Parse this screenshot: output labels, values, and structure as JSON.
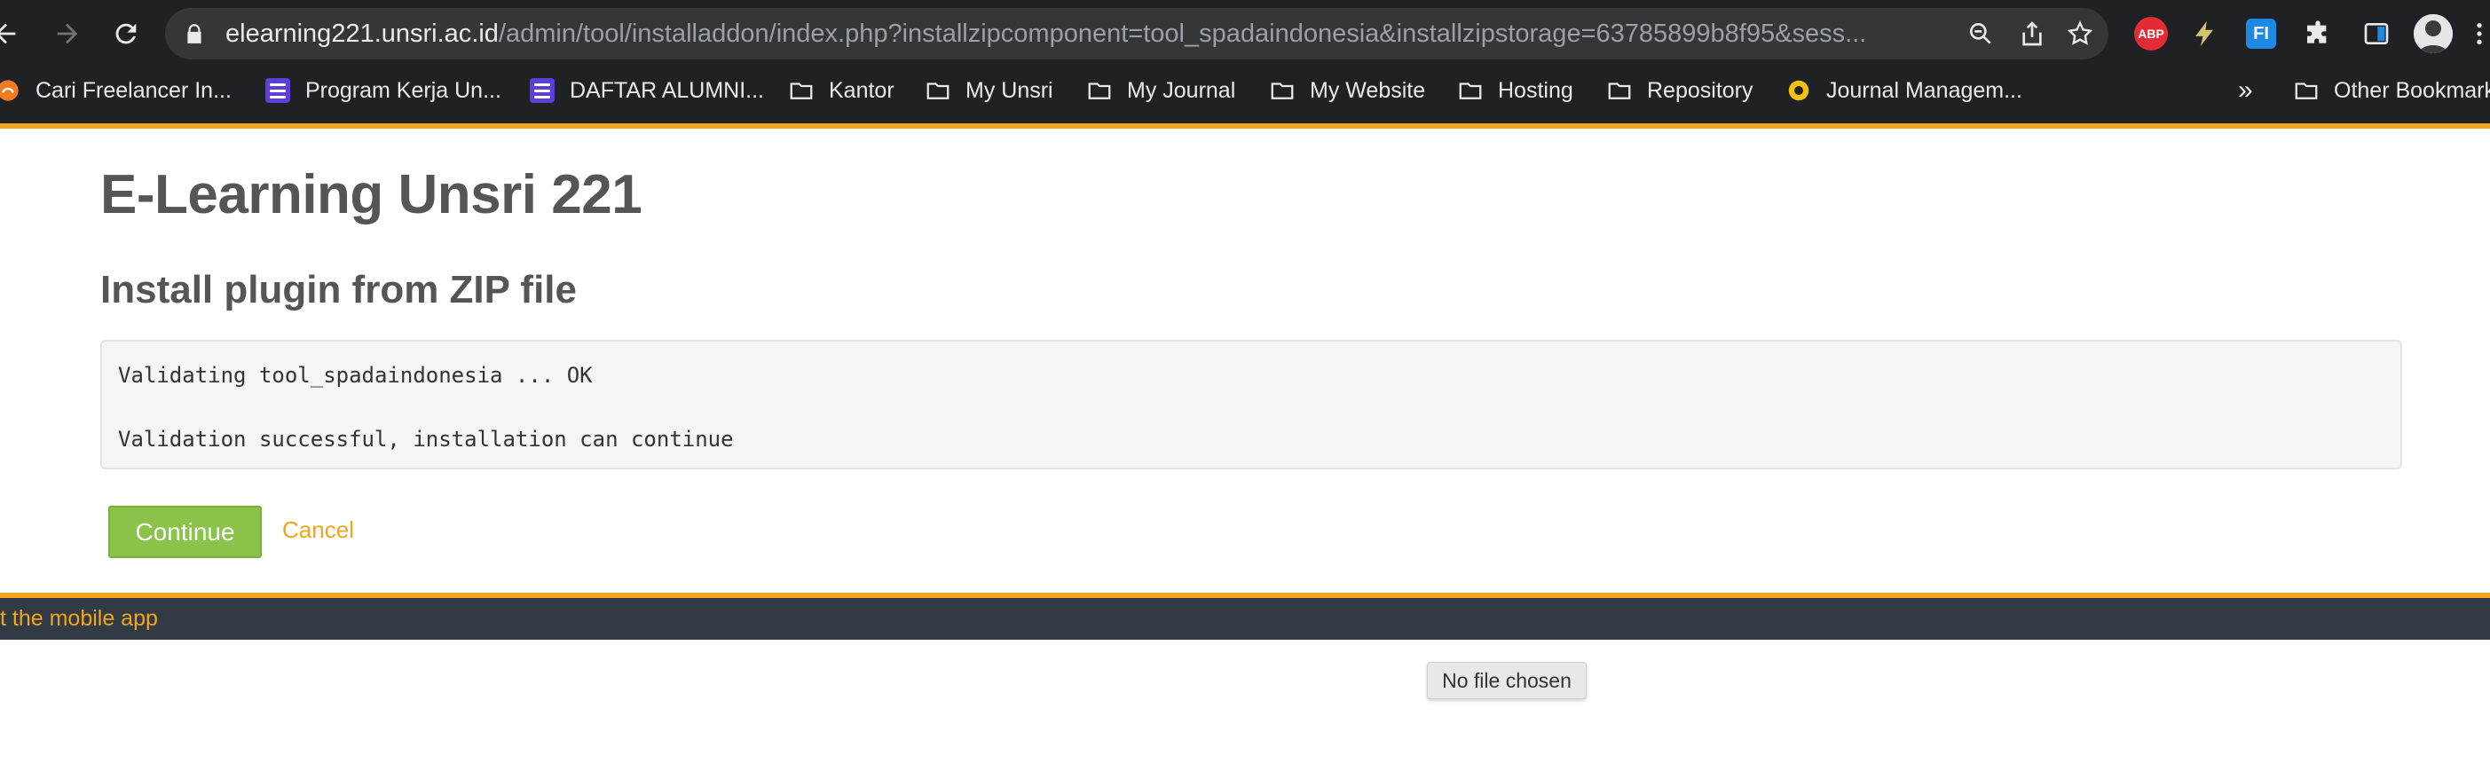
{
  "browser": {
    "url_host": "elearning221.unsri.ac.id",
    "url_path": "/admin/tool/installaddon/index.php?installzipcomponent=tool_spadaindonesia&installzipstorage=63785899b8f95&sess...",
    "icons": [
      "back-arrow-icon",
      "forward-arrow-icon",
      "reload-icon",
      "lock-icon",
      "zoom-icon",
      "share-icon",
      "bookmark-star-icon",
      "adblock-plus-icon",
      "lightning-extension-icon",
      "fi-extension-icon",
      "puzzle-extensions-icon",
      "sidebar-icon",
      "profile-avatar",
      "menu-dots-icon"
    ],
    "abp_label": "ABP",
    "fi_label": "FI",
    "overflow_label": "»",
    "bookmarks": [
      {
        "label": "Cari Freelancer In...",
        "icon": "orange-site-icon"
      },
      {
        "label": "Program Kerja Un...",
        "icon": "purple-list-icon"
      },
      {
        "label": "DAFTAR ALUMNI...",
        "icon": "purple-list-icon"
      },
      {
        "label": "Kantor",
        "icon": "folder-icon"
      },
      {
        "label": "My Unsri",
        "icon": "folder-icon"
      },
      {
        "label": "My Journal",
        "icon": "folder-icon"
      },
      {
        "label": "My Website",
        "icon": "folder-icon"
      },
      {
        "label": "Hosting",
        "icon": "folder-icon"
      },
      {
        "label": "Repository",
        "icon": "folder-icon"
      },
      {
        "label": "Journal Managem...",
        "icon": "yellow-flower-icon"
      },
      {
        "label": "Other Bookmarks",
        "icon": "folder-icon"
      }
    ]
  },
  "page": {
    "site_name": "E-Learning Unsri 221",
    "heading": "Install plugin from ZIP file",
    "log": {
      "line1": "Validating tool_spadaindonesia ... OK",
      "line2": "Validation successful, installation can continue"
    },
    "continue_label": "Continue",
    "cancel_label": "Cancel"
  },
  "footer": {
    "link_label": "t the mobile app"
  },
  "file_input": {
    "status": "No file chosen"
  },
  "colors": {
    "chrome_bg": "#202124",
    "omnibox_bg": "#35363a",
    "accent": "#f0a51b",
    "button_green": "#8bc34a",
    "footer_bg": "#313a45",
    "heading_text": "#555555"
  }
}
